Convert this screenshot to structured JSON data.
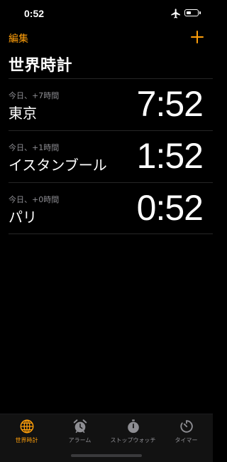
{
  "status_bar": {
    "time": "0:52",
    "airplane_mode": true,
    "battery_level": 0.45
  },
  "header": {
    "edit_label": "編集",
    "add_icon": "plus-icon",
    "title": "世界時計"
  },
  "clocks": [
    {
      "offset": "今日、+7時間",
      "city": "東京",
      "time": "7:52"
    },
    {
      "offset": "今日、+1時間",
      "city": "イスタンブール",
      "time": "1:52"
    },
    {
      "offset": "今日、+0時間",
      "city": "パリ",
      "time": "0:52"
    }
  ],
  "tab_bar": {
    "items": [
      {
        "label": "世界時計",
        "icon": "globe-icon",
        "active": true
      },
      {
        "label": "アラーム",
        "icon": "alarm-clock-icon",
        "active": false
      },
      {
        "label": "ストップウォッチ",
        "icon": "stopwatch-icon",
        "active": false
      },
      {
        "label": "タイマー",
        "icon": "timer-icon",
        "active": false
      }
    ]
  },
  "colors": {
    "accent": "#ff9f0a",
    "background": "#000000",
    "secondary_text": "#8e8e93",
    "inactive_icon": "#8e8e93"
  }
}
